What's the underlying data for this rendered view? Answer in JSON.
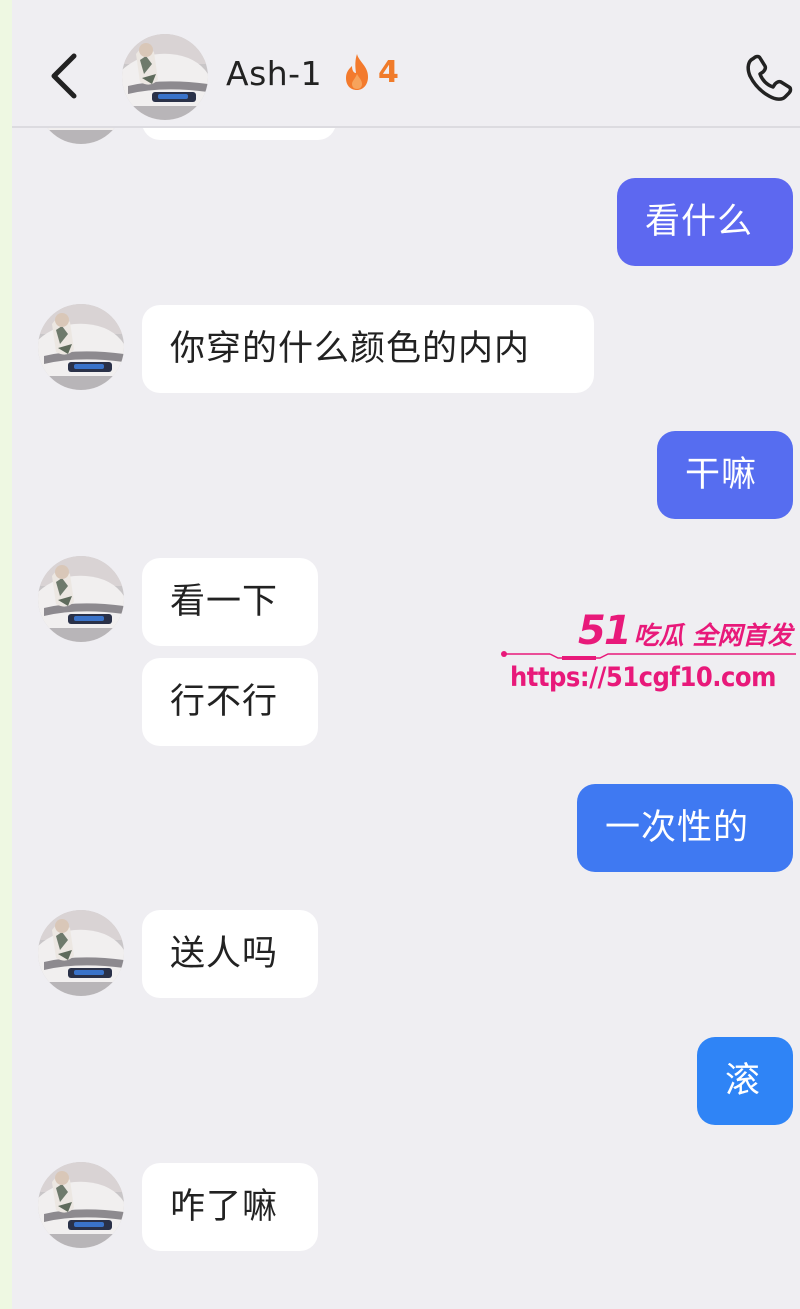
{
  "header": {
    "contact_name": "Ash-1",
    "streak_count": "4",
    "back_icon": "chevron-left-icon",
    "call_icon": "phone-icon",
    "streak_icon": "flame-icon"
  },
  "messages": [
    {
      "direction": "incoming",
      "text": ""
    },
    {
      "direction": "outgoing",
      "text": "看什么"
    },
    {
      "direction": "incoming",
      "text": "你穿的什么颜色的内内"
    },
    {
      "direction": "outgoing",
      "text": "干嘛"
    },
    {
      "direction": "incoming",
      "text": "看一下"
    },
    {
      "direction": "incoming",
      "text": "行不行"
    },
    {
      "direction": "outgoing",
      "text": "一次性的"
    },
    {
      "direction": "incoming",
      "text": "送人吗"
    },
    {
      "direction": "outgoing",
      "text": "滚"
    },
    {
      "direction": "incoming",
      "text": "咋了嘛"
    }
  ],
  "watermark": {
    "brand_number": "51",
    "brand_text": "吃瓜 全网首发",
    "url": "https://51cgf10.com"
  },
  "colors": {
    "outgoing_bubble_top": "#5a6cf2",
    "outgoing_bubble_bottom": "#2f86f6",
    "incoming_bubble": "#ffffff",
    "background": "#efeef2",
    "watermark": "#e8197a",
    "streak": "#f07b2a"
  }
}
